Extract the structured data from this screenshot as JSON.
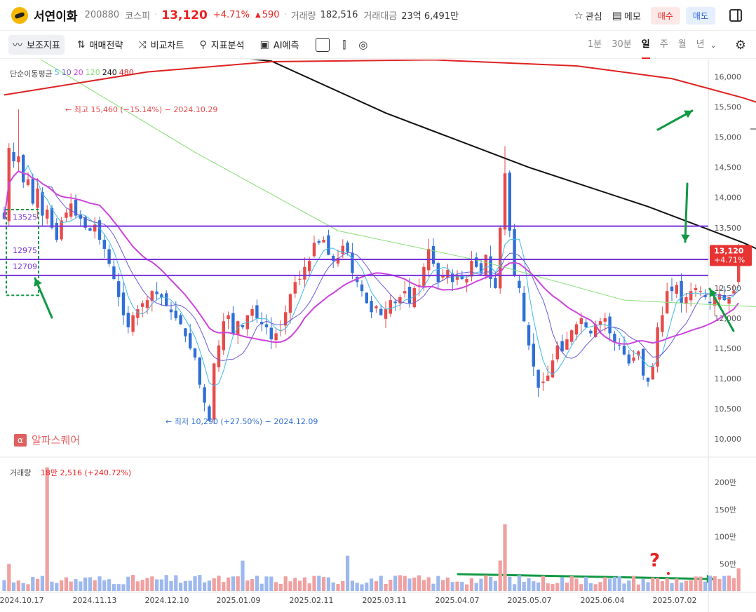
{
  "header": {
    "name": "서연이화",
    "code": "200880",
    "market": "코스피",
    "price": "13,120",
    "change_pct": "+4.71%",
    "change_abs": "590",
    "volume_label": "거래량",
    "volume_value": "182,516",
    "amount_label": "거래대금",
    "amount_value": "23억 6,491만",
    "watch_label": "관심",
    "memo_label": "메모",
    "buy_label": "매수",
    "sell_label": "매도"
  },
  "toolbar": {
    "indicator_label": "보조지표",
    "strategy_label": "매매전략",
    "compare_label": "비교차트",
    "analysis_label": "지표분석",
    "ai_label": "AI예측",
    "periods": [
      "1분",
      "30분",
      "일",
      "주",
      "월",
      "년"
    ],
    "active_period": "일"
  },
  "ma_legend": {
    "label": "단순이동평균",
    "periods": [
      "5",
      "10",
      "20",
      "120",
      "240",
      "480"
    ]
  },
  "colors": {
    "up": "#e84a4a",
    "down": "#2f6fd6",
    "ma5": "#3fb9e8",
    "ma10": "#6a5ad6",
    "ma20": "#cc44dd",
    "ma120": "#88dd77",
    "ma240": "#111111",
    "ma480": "#dd2222",
    "hline": "#7733dd",
    "annot": "#119944"
  },
  "annotations": {
    "high": "최고 15,460 (−15.14%) − 2024.10.29",
    "low": "최저 10,290 (+27.50%) − 2024.12.09",
    "levels": [
      "13525",
      "12975",
      "12709"
    ],
    "price_tag": "13,120",
    "price_tag_pct": "+4.71%",
    "question": "?"
  },
  "brand": {
    "name": "알파스퀘어",
    "icon": "α"
  },
  "volume_legend": {
    "label": "거래량",
    "value": "18만 2,516 (+240.72%)"
  },
  "chart_data": {
    "type": "candlestick",
    "price_axis": {
      "ylim": [
        9700,
        16250
      ],
      "ticks": [
        "16,000",
        "15,500",
        "15,000",
        "14,500",
        "14,000",
        "13,500",
        "13,000",
        "12,500",
        "12,000",
        "11,500",
        "11,000",
        "10,500",
        "10,000"
      ]
    },
    "volume_axis": {
      "ylim": [
        0,
        2300000
      ],
      "ticks": [
        "200만",
        "150만",
        "100만",
        "50만"
      ]
    },
    "x_labels": [
      "2024.10.17",
      "2024.11.13",
      "2024.12.10",
      "2025.01.09",
      "2025.02.11",
      "2025.03.11",
      "2025.04.07",
      "2025.05.07",
      "2025.06.04",
      "2025.07.02"
    ],
    "horizontal_levels": [
      13525,
      12975,
      12709
    ],
    "closes": [
      13650,
      14820,
      14600,
      14680,
      14250,
      14300,
      13900,
      14150,
      13700,
      13800,
      13500,
      13300,
      13620,
      13750,
      13900,
      13700,
      13650,
      13500,
      13450,
      13550,
      13300,
      13150,
      12900,
      12650,
      12350,
      12050,
      11850,
      12050,
      12150,
      12250,
      12300,
      12450,
      12400,
      12350,
      12200,
      12100,
      12000,
      11900,
      11700,
      11500,
      11350,
      10900,
      10600,
      10300,
      11250,
      11550,
      11950,
      12050,
      11750,
      11950,
      11850,
      12050,
      12150,
      12000,
      11900,
      11850,
      11650,
      11750,
      11800,
      12100,
      12400,
      12600,
      12650,
      12850,
      12950,
      13250,
      13250,
      13300,
      13050,
      12950,
      13000,
      13200,
      13100,
      12750,
      12600,
      12450,
      12250,
      12100,
      12200,
      12050,
      12150,
      12300,
      12250,
      12350,
      12450,
      12250,
      12500,
      12550,
      12850,
      13150,
      12900,
      12600,
      12700,
      12800,
      12600,
      12700,
      12650,
      12650,
      12950,
      12850,
      12750,
      13050,
      12650,
      12500,
      13500,
      14400,
      13450,
      12700,
      12500,
      11950,
      11550,
      11200,
      10850,
      10950,
      11050,
      11300,
      11550,
      11450,
      11650,
      11800,
      11900,
      12000,
      11850,
      11750,
      11900,
      11950,
      12000,
      11750,
      11600,
      11550,
      11400,
      11250,
      11350,
      11450,
      11050,
      10950,
      11200,
      11850,
      12050,
      12450,
      12450,
      12550,
      12250,
      12350,
      12450,
      12500,
      12450,
      12350,
      12250,
      12350,
      12400,
      12300,
      12350,
      12450,
      13120
    ]
  }
}
